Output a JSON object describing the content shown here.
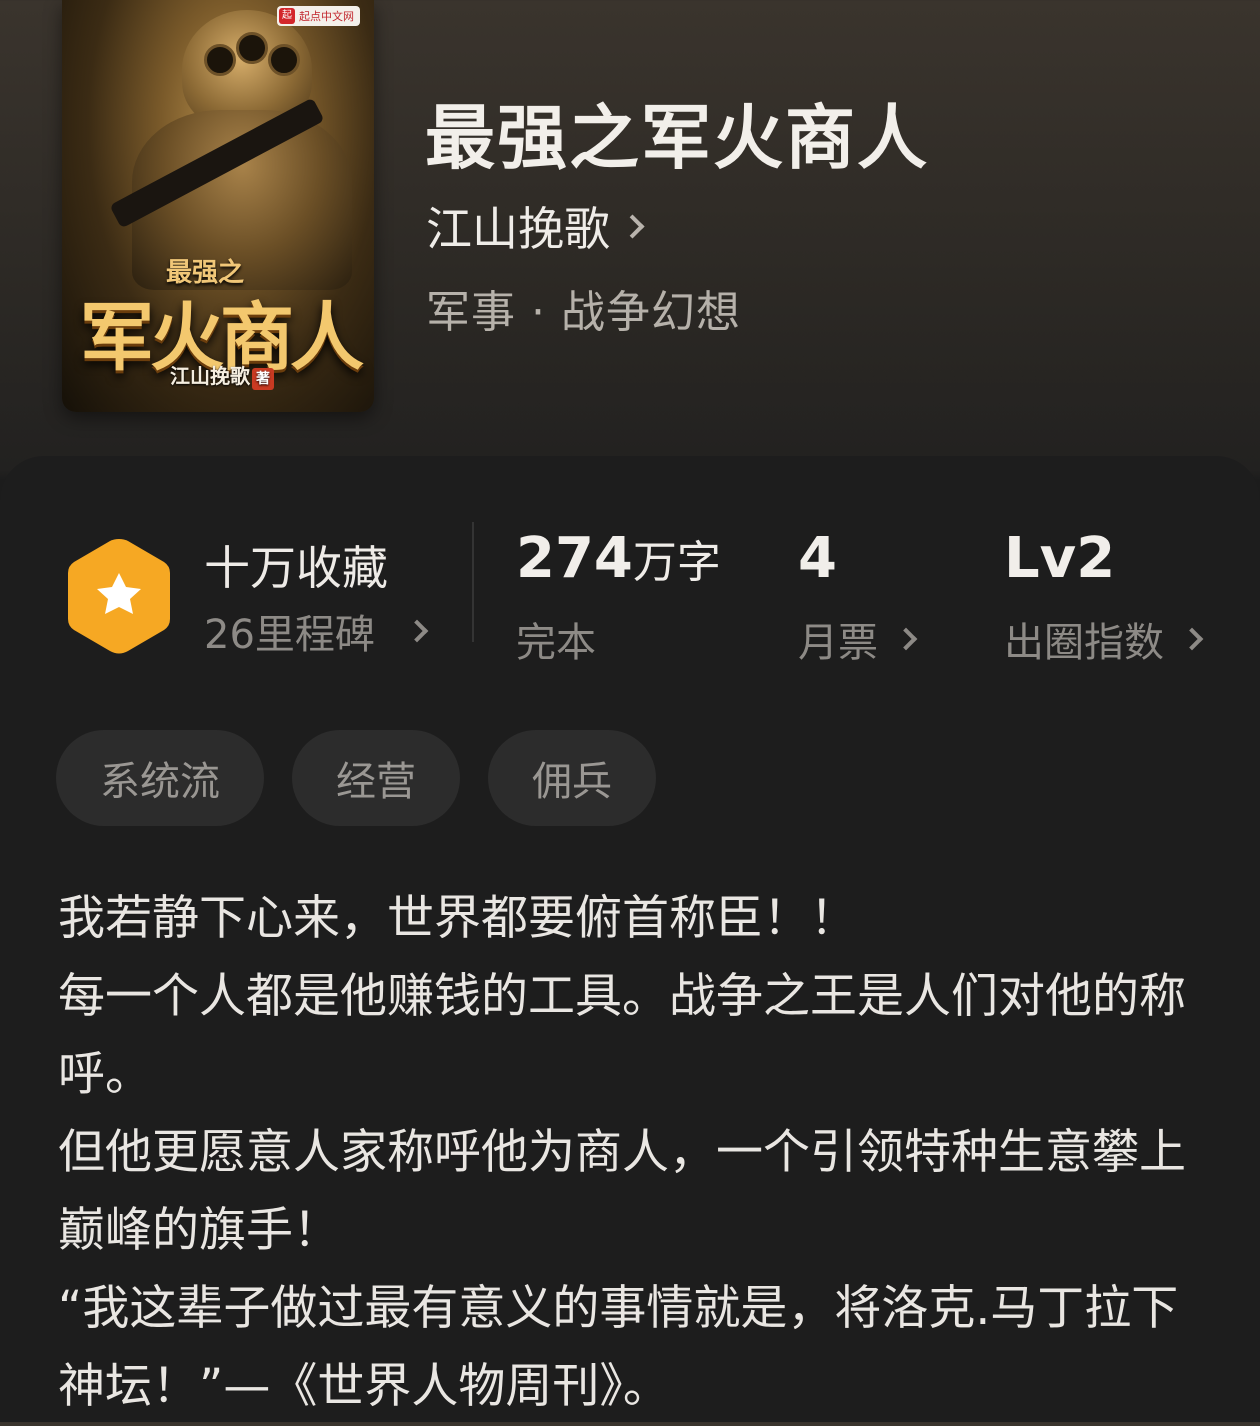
{
  "book": {
    "title": "最强之军火商人",
    "author": "江山挽歌",
    "genre": "军事 · 战争幻想",
    "cover": {
      "publisher_logo": "起点中文网",
      "logo_mark": "起",
      "title_small": "最强之",
      "title_big": "军火商人",
      "author_credit": "江山挽歌",
      "author_seal": "著"
    }
  },
  "stats": {
    "favorites_label": "十万收藏",
    "milestones": "26里程碑",
    "word_count_value": "274",
    "word_count_unit": "万字",
    "status": "完本",
    "monthly_votes_value": "4",
    "monthly_votes_label": "月票",
    "breakout_value": "Lv2",
    "breakout_label": "出圈指数"
  },
  "tags": [
    "系统流",
    "经营",
    "佣兵"
  ],
  "intro": [
    "我若静下心来，世界都要俯首称臣！！",
    "每一个人都是他赚钱的工具。战争之王是人们对他的称呼。",
    "但他更愿意人家称呼他为商人，一个引领特种生意攀上巅峰的旗手！",
    "“我这辈子做过最有意义的事情就是，将洛克.马丁拉下神坛！”—《世界人物周刊》。"
  ],
  "colors": {
    "badge": "#f6a823",
    "panel": "#1d1d1d",
    "tag_bg": "#2c2c2c"
  },
  "icons": {
    "badge": "star-hexagon-icon",
    "chevron": "chevron-right-icon"
  }
}
